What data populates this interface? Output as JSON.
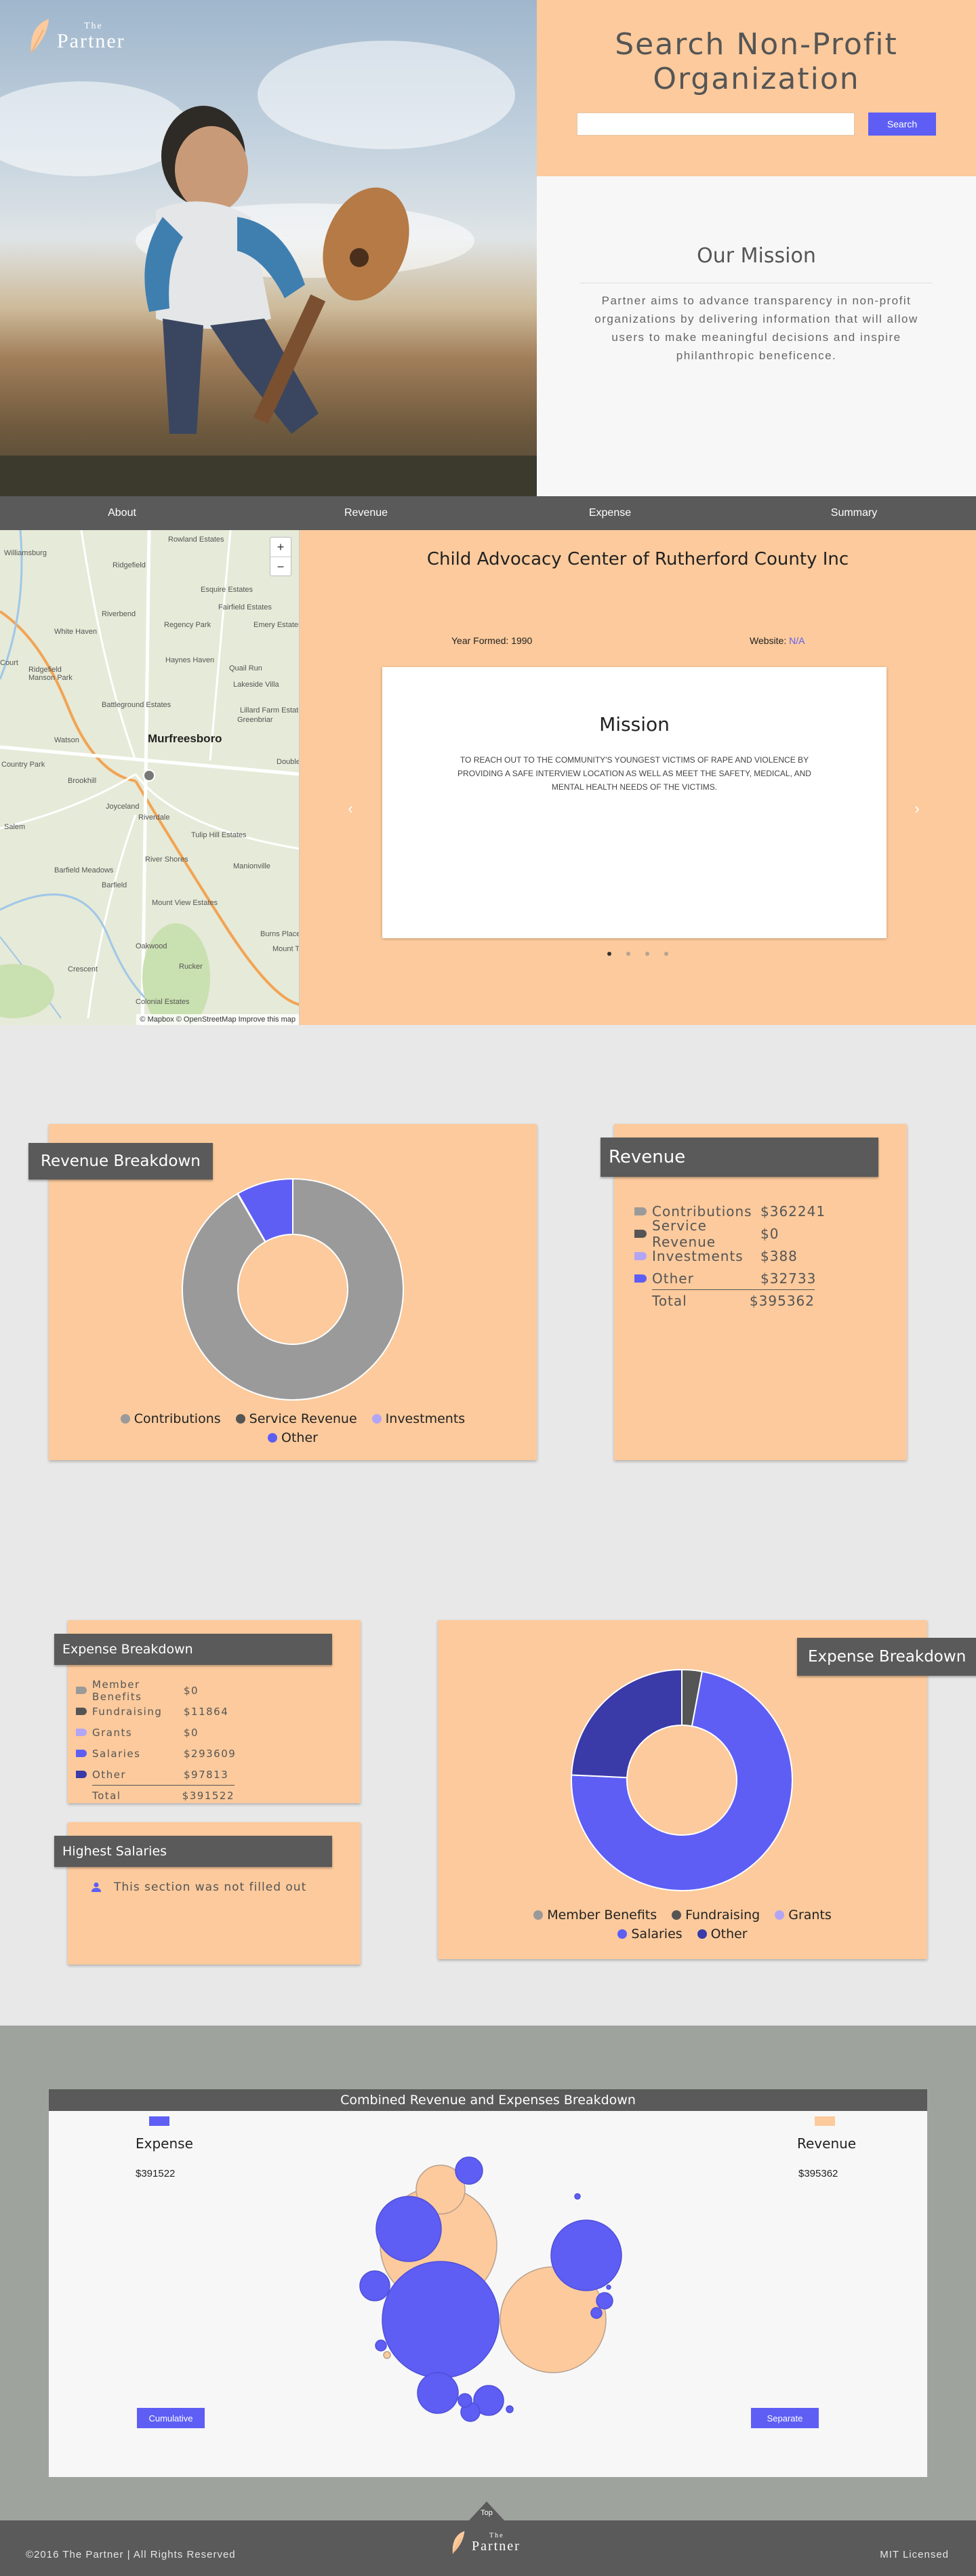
{
  "brand": {
    "the": "The",
    "partner": "Partner"
  },
  "search": {
    "title": "Search Non-Profit Organization",
    "placeholder": "",
    "button_label": "Search"
  },
  "our_mission": {
    "title": "Our Mission",
    "text": "Partner aims to advance transparency in non-profit organizations by delivering information that will allow users to make meaningful decisions and inspire philanthropic beneficence."
  },
  "nav": {
    "items": [
      "About",
      "Revenue",
      "Expense",
      "Summary"
    ]
  },
  "map": {
    "zoom_in": "+",
    "zoom_out": "−",
    "attribution": "© Mapbox © OpenStreetMap  Improve this map",
    "city": "Murfreesboro",
    "labels": [
      "Williamsburg",
      "Rowland Estates",
      "Ridgefield",
      "Esquire Estates",
      "Fairfield Estates",
      "Riverbend",
      "Regency Park",
      "Emery Estates",
      "White Haven",
      "Haynes Haven",
      "Quail Run",
      "Lakeside Villa",
      "Court",
      "Ridgefield Manson Park",
      "Battleground Estates",
      "Lillard Farm Estates",
      "Greenbriar",
      "Watson",
      "Country Park",
      "Brookhill",
      "Joyceland",
      "Riverdale",
      "Tulip Hill Estates",
      "Salem",
      "River Shores",
      "Manionville",
      "Barfield Meadows",
      "Barfield",
      "Mount View Estates",
      "Crescent",
      "Oakwood",
      "Rucker",
      "Colonial Estates",
      "Burns Place",
      "Mount Ter",
      "Double"
    ]
  },
  "org": {
    "name": "Child Advocacy Center of Rutherford County Inc",
    "year_label": "Year Formed: 1990",
    "website_label": "Website:",
    "website_value": "N/A",
    "mission_title": "Mission",
    "mission_text": "TO REACH OUT TO THE COMMUNITY'S YOUNGEST VICTIMS OF RAPE AND VIOLENCE BY PROVIDING A SAFE INTERVIEW LOCATION AS WELL AS MEET THE SAFETY, MEDICAL, AND MENTAL HEALTH NEEDS OF THE VICTIMS.",
    "prev_arrow": "‹",
    "next_arrow": "›",
    "active_slide": 0,
    "slide_count": 4
  },
  "revenue_breakdown": {
    "title": "Revenue Breakdown",
    "legend": [
      "Contributions",
      "Service Revenue",
      "Investments",
      "Other"
    ]
  },
  "revenue": {
    "title": "Revenue",
    "rows": [
      {
        "label": "Contributions",
        "value": "$362241"
      },
      {
        "label": "Service Revenue",
        "value": "$0"
      },
      {
        "label": "Investments",
        "value": "$388"
      },
      {
        "label": "Other",
        "value": "$32733"
      }
    ],
    "total_label": "Total",
    "total_value": "$395362"
  },
  "expense_table": {
    "title": "Expense Breakdown",
    "rows": [
      {
        "label": "Member Benefits",
        "value": "$0"
      },
      {
        "label": "Fundraising",
        "value": "$11864"
      },
      {
        "label": "Grants",
        "value": "$0"
      },
      {
        "label": "Salaries",
        "value": "$293609"
      },
      {
        "label": "Other",
        "value": "$97813"
      }
    ],
    "total_label": "Total",
    "total_value": "$391522"
  },
  "salaries": {
    "title": "Highest Salaries",
    "empty_text": "This section was not filled out"
  },
  "expense_breakdown": {
    "title": "Expense Breakdown",
    "legend": [
      "Member Benefits",
      "Fundraising",
      "Grants",
      "Salaries",
      "Other"
    ]
  },
  "combined": {
    "title": "Combined Revenue and Expenses Breakdown",
    "expense_label": "Expense",
    "expense_value": "$391522",
    "revenue_label": "Revenue",
    "revenue_value": "$395362",
    "cumulative_label": "Cumulative",
    "separate_label": "Separate"
  },
  "footer": {
    "copyright": "©2016 The Partner | All Rights Reserved",
    "license": "MIT Licensed",
    "top_label": "Top"
  },
  "colors": {
    "accent": "#5e5ef5",
    "peach": "#fcca9c",
    "dark": "#5a5a5a",
    "contributions": "#9a9a9a",
    "service_revenue": "#555555",
    "investments": "#b3a5f5",
    "other": "#5e5ef5",
    "member_benefits": "#9a9a9a",
    "fundraising": "#555555",
    "grants": "#b3a5f5",
    "salaries": "#5e5ef5",
    "expense_other": "#3a3aa8"
  },
  "chart_data": [
    {
      "type": "pie",
      "title": "Revenue Breakdown",
      "categories": [
        "Contributions",
        "Service Revenue",
        "Investments",
        "Other"
      ],
      "values": [
        362241,
        0,
        388,
        32733
      ],
      "colors": [
        "#9a9a9a",
        "#555555",
        "#b3a5f5",
        "#5e5ef5"
      ],
      "legend": "bottom"
    },
    {
      "type": "pie",
      "title": "Expense Breakdown",
      "categories": [
        "Member Benefits",
        "Fundraising",
        "Grants",
        "Salaries",
        "Other"
      ],
      "values": [
        0,
        11864,
        0,
        293609,
        97813
      ],
      "colors": [
        "#9a9a9a",
        "#555555",
        "#b3a5f5",
        "#5e5ef5",
        "#3a3aa8"
      ],
      "legend": "bottom"
    }
  ]
}
